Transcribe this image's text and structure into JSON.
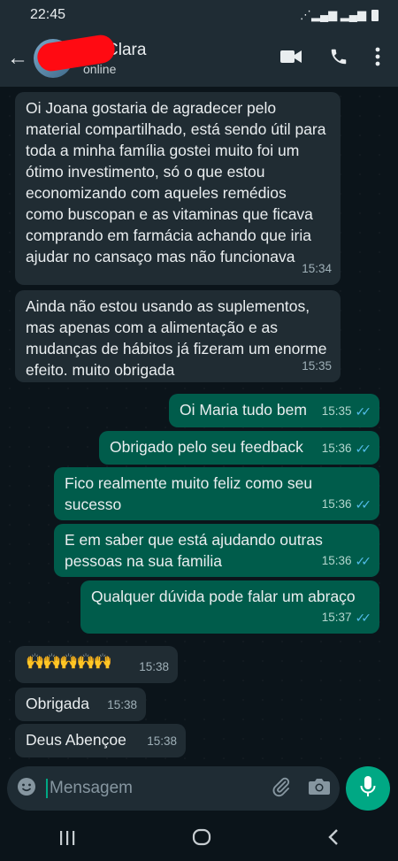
{
  "status_bar": {
    "time": "22:45",
    "signal": "⋰▂▄▆ ▂▄▆"
  },
  "header": {
    "name": "Clara",
    "status": "online"
  },
  "messages": [
    {
      "direction": "in",
      "text": "Oi Joana gostaria de agradecer pelo material compartilhado, está sendo útil para toda a minha família gostei muito foi um ótimo investimento, só o que estou economizando com aqueles remédios como buscopan e as vitaminas que ficava comprando em farmácia achando que iria ajudar no cansaço mas não funcionava",
      "time": "15:34"
    },
    {
      "direction": "in",
      "text": "Ainda não estou usando as suplementos, mas apenas com a alimentação e as mudanças de hábitos já fizeram um enorme efeito. muito obrigada",
      "time": "15:35"
    },
    {
      "direction": "out",
      "text": "Oi Maria tudo bem",
      "time": "15:35"
    },
    {
      "direction": "out",
      "text": "Obrigado pelo seu feedback",
      "time": "15:36"
    },
    {
      "direction": "out",
      "text": "Fico realmente muito feliz como seu sucesso",
      "time": "15:36"
    },
    {
      "direction": "out",
      "text": "E em saber que está ajudando outras pessoas na sua familia",
      "time": "15:36"
    },
    {
      "direction": "out",
      "text": "Qualquer dúvida pode falar um abraço",
      "time": "15:37"
    },
    {
      "direction": "in",
      "text": "🙌🙌🙌🙌🙌",
      "time": "15:38"
    },
    {
      "direction": "in",
      "text": "Obrigada",
      "time": "15:38"
    },
    {
      "direction": "in",
      "text": "Deus Abençoe",
      "time": "15:38"
    }
  ],
  "input": {
    "placeholder": "Mensagem"
  },
  "icons": {
    "back": "arrow-back-icon",
    "video": "video-call-icon",
    "call": "phone-call-icon",
    "menu": "more-vert-icon",
    "emoji": "emoji-icon",
    "attach": "attach-icon",
    "camera": "camera-icon",
    "mic": "mic-icon",
    "read_receipt": "double-check-icon"
  },
  "colors": {
    "incoming_bubble": "#202c33",
    "outgoing_bubble": "#005c4b",
    "accent": "#00a884",
    "read_tick": "#53bdeb"
  }
}
